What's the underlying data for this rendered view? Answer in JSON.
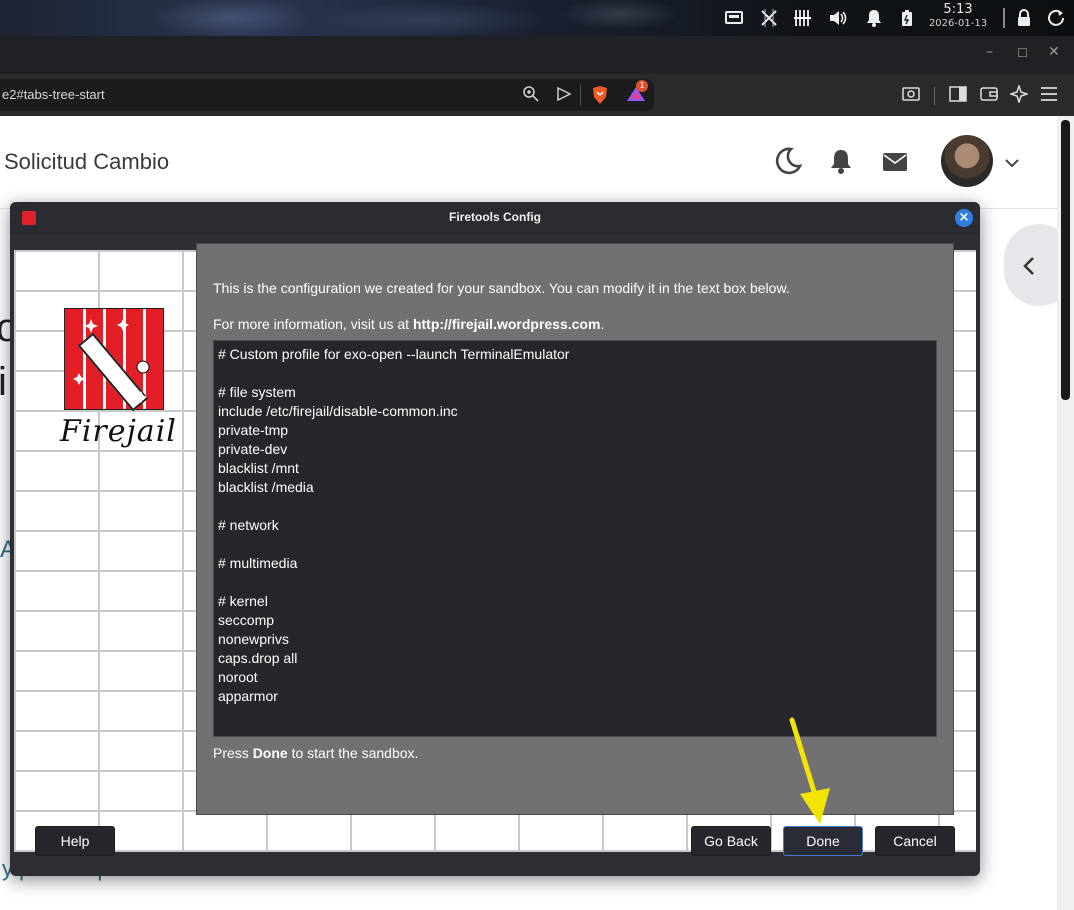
{
  "system_tray": {
    "time": "5:13",
    "date": "2026-01-13",
    "icons": [
      "screen-icon",
      "tools-icon",
      "network-icon",
      "volume-icon",
      "notifications-icon",
      "battery-icon",
      "lock-icon",
      "power-icon"
    ]
  },
  "browser": {
    "url_fragment": "e2#tabs-tree-start",
    "notification_count": "1",
    "window_controls": [
      "minimize",
      "maximize",
      "close"
    ]
  },
  "page": {
    "title": "Solicitud Cambio",
    "footer_link": "y para dispositivos móviles",
    "fragments": [
      "o",
      "i",
      "A"
    ]
  },
  "dialog": {
    "title": "Firetools Config",
    "logo_text": "Firejail",
    "intro_line1": "This is the configuration we created for your sandbox. You can modify it in the text box below.",
    "intro_line2_prefix": "For more information, visit us at ",
    "intro_line2_link": "http://firejail.wordpress.com",
    "intro_line2_suffix": ".",
    "profile_lines": [
      "# Custom profile for exo-open --launch TerminalEmulator",
      "",
      "# file system",
      "include /etc/firejail/disable-common.inc",
      "private-tmp",
      "private-dev",
      "blacklist /mnt",
      "blacklist /media",
      "",
      "# network",
      "",
      "# multimedia",
      "",
      "# kernel",
      "seccomp",
      "nonewprivs",
      "caps.drop all",
      "noroot",
      "apparmor"
    ],
    "hint_prefix": "Press ",
    "hint_bold": "Done",
    "hint_suffix": " to start the sandbox.",
    "buttons": {
      "help": "Help",
      "go_back": "Go Back",
      "done": "Done",
      "cancel": "Cancel"
    }
  },
  "colors": {
    "annotation_arrow": "#f2e400",
    "brand_red": "#e41e26",
    "close_blue": "#2f7fe0"
  }
}
